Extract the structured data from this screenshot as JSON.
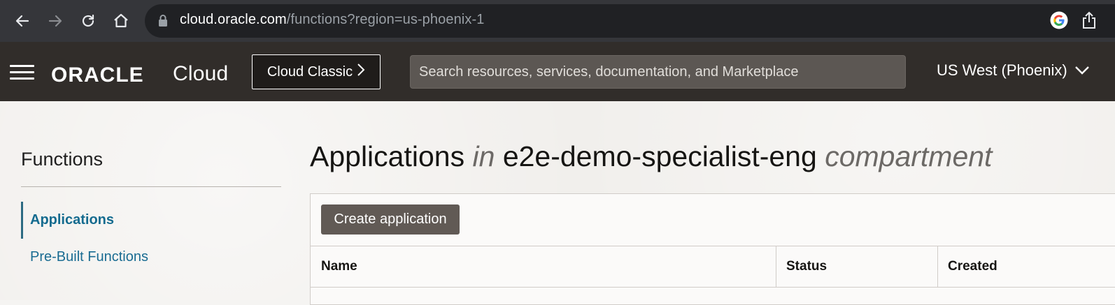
{
  "browser": {
    "url_host": "cloud.oracle.com",
    "url_rest": "/functions?region=us-phoenix-1",
    "icons": [
      "back-arrow-icon",
      "forward-arrow-icon",
      "reload-icon",
      "home-icon",
      "lock-icon",
      "google-icon",
      "share-icon"
    ]
  },
  "header": {
    "logo_oracle": "ORACLE",
    "logo_cloud": "Cloud",
    "cloud_classic_label": "Cloud Classic",
    "search_placeholder": "Search resources, services, documentation, and Marketplace",
    "region_label": "US West (Phoenix)"
  },
  "sidebar": {
    "title": "Functions",
    "items": [
      {
        "label": "Applications",
        "active": true
      },
      {
        "label": "Pre-Built Functions",
        "active": false
      }
    ]
  },
  "main": {
    "title_prefix": "Applications",
    "title_in": "in",
    "title_compartment": "e2e-demo-specialist-eng",
    "title_suffix": "compartment",
    "create_button": "Create application",
    "columns": [
      "Name",
      "Status",
      "Created"
    ]
  },
  "colors": {
    "browser_bg": "#35363a",
    "header_bg": "#312d2a",
    "link": "#146b8f",
    "button_bg": "#615a55"
  }
}
